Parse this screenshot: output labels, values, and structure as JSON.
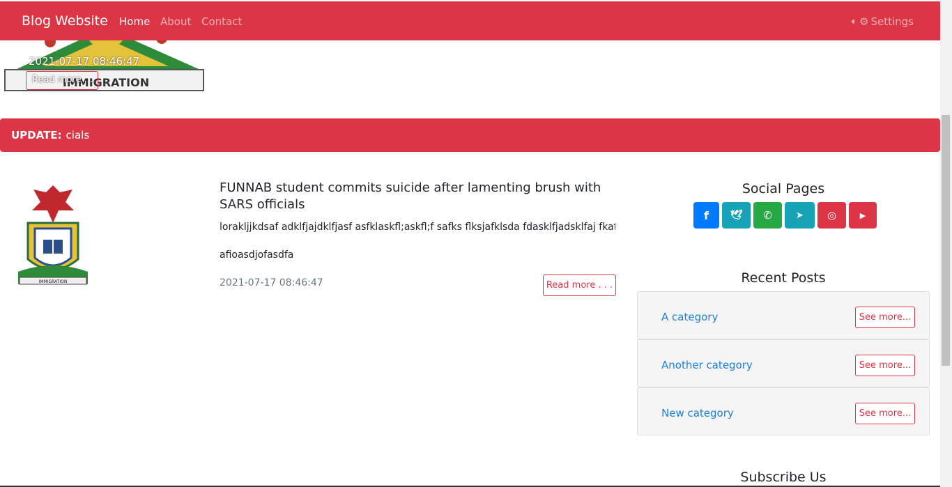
{
  "navbar": {
    "brand": "Blog Website",
    "links": [
      {
        "label": "Home",
        "active": true
      },
      {
        "label": "About",
        "active": false
      },
      {
        "label": "Contact",
        "active": false
      }
    ],
    "settings_label": "Settings",
    "color": "#dc3545"
  },
  "hero": {
    "date": "2021-07-17 08:46:47",
    "read_more": "Read more . . ."
  },
  "update": {
    "label": "UPDATE:",
    "text": "cials"
  },
  "post": {
    "title": "FUNNAB student commits suicide after lamenting brush with SARS officials",
    "excerpt": "lorakljjkdsaf adklfjajdklfjasf asfklaskfl;askfl;f safks flksjafklsda fdasklfjadsklfaj fkaf jaksf",
    "excerpt2": "afioasdjofasdfa",
    "date": "2021-07-17 08:46:47",
    "read_more": "Read more . . ."
  },
  "sidebar": {
    "social_heading": "Social Pages",
    "social": [
      {
        "icon": "facebook-icon",
        "glyph": "f",
        "color": "#007bff"
      },
      {
        "icon": "twitter-icon",
        "glyph": "🐦",
        "color": "#17a2b8"
      },
      {
        "icon": "whatsapp-icon",
        "glyph": "✆",
        "color": "#28a745"
      },
      {
        "icon": "telegram-icon",
        "glyph": "➤",
        "color": "#17a2b8"
      },
      {
        "icon": "instagram-icon",
        "glyph": "◎",
        "color": "#dc3545"
      },
      {
        "icon": "youtube-icon",
        "glyph": "▶",
        "color": "#dc3545"
      }
    ],
    "recent_heading": "Recent Posts",
    "recent": [
      {
        "label": "A category",
        "button": "See more..."
      },
      {
        "label": "Another category",
        "button": "See more..."
      },
      {
        "label": "New category",
        "button": "See more..."
      }
    ],
    "subscribe_heading": "Subscribe Us"
  }
}
